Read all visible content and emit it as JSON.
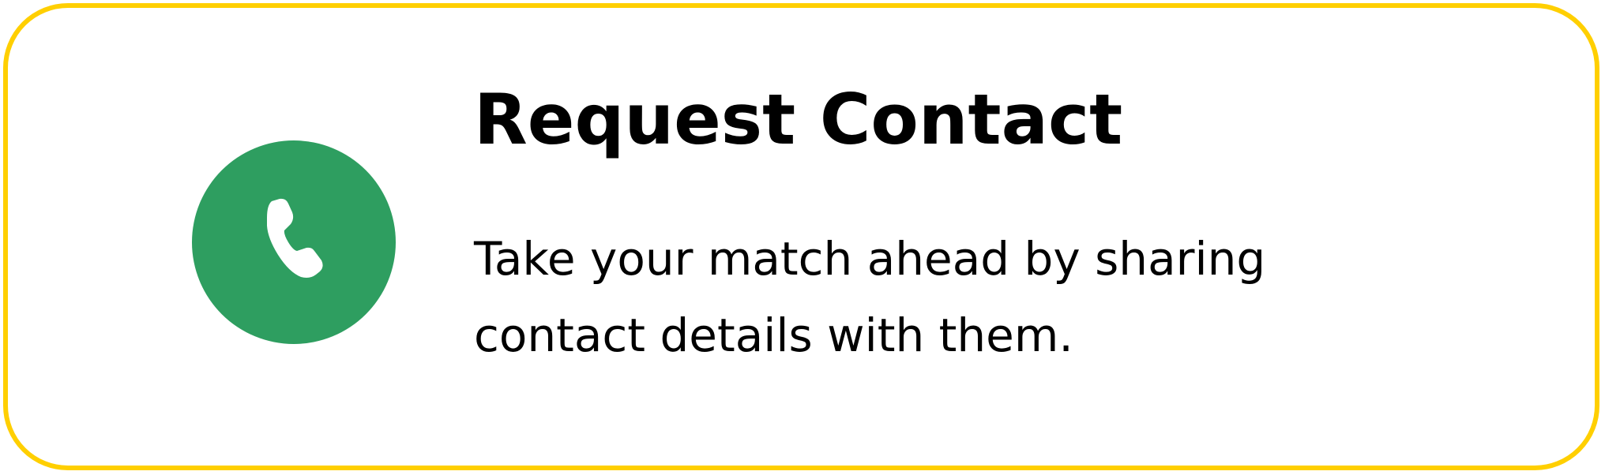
{
  "card": {
    "border_color": "#FFCF00",
    "icon": "phone-icon",
    "icon_background": "#2E9E60",
    "title": "Request Contact",
    "description": "Take your match ahead by sharing contact details with them."
  }
}
